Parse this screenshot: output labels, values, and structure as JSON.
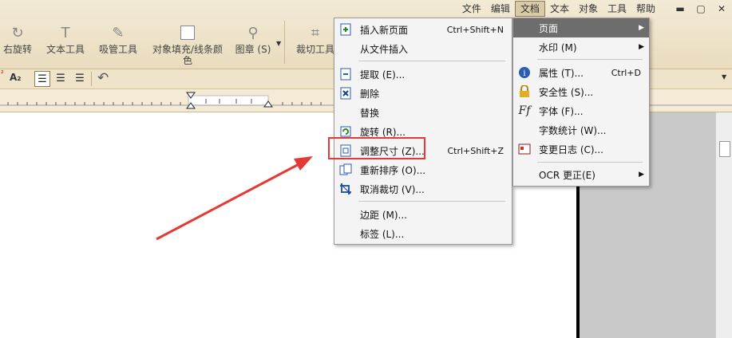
{
  "menubar": [
    "文件",
    "编辑",
    "文档",
    "文本",
    "对象",
    "工具",
    "帮助"
  ],
  "toolbar": {
    "tools": [
      "右旋转",
      "文本工具",
      "吸管工具",
      "对象填充/线条颜色",
      "图章 (S)",
      "裁切工具"
    ]
  },
  "format_bar": {
    "sup_label": "²",
    "sub_label": "A₂"
  },
  "doc_menu": {
    "items": [
      {
        "label": "插入新页面",
        "shortcut": "Ctrl+Shift+N",
        "icon": "insert-page-icon"
      },
      {
        "label": "从文件插入",
        "shortcut": ""
      },
      {
        "label": "提取 (E)...",
        "shortcut": "",
        "icon": "extract-icon"
      },
      {
        "label": "删除",
        "shortcut": "",
        "icon": "delete-page-icon"
      },
      {
        "label": "替换",
        "shortcut": ""
      },
      {
        "label": "旋转 (R)...",
        "shortcut": "",
        "icon": "rotate-icon"
      },
      {
        "label": "调整尺寸 (Z)...",
        "shortcut": "Ctrl+Shift+Z",
        "icon": "resize-icon",
        "highlighted": true
      },
      {
        "label": "重新排序 (O)...",
        "shortcut": "",
        "icon": "reorder-icon"
      },
      {
        "label": "取消裁切 (V)...",
        "shortcut": "",
        "icon": "uncrop-icon"
      },
      {
        "label": "边距 (M)...",
        "shortcut": ""
      },
      {
        "label": "标签 (L)...",
        "shortcut": ""
      }
    ]
  },
  "doc_submenu": {
    "items": [
      {
        "label": "页面",
        "has_arrow": true,
        "selected": true
      },
      {
        "label": "水印 (M)",
        "has_arrow": true
      },
      {
        "label": "属性 (T)...",
        "shortcut": "Ctrl+D",
        "icon": "info-icon"
      },
      {
        "label": "安全性 (S)...",
        "icon": "lock-icon"
      },
      {
        "label": "字体 (F)...",
        "icon": "font-icon"
      },
      {
        "label": "字数统计 (W)..."
      },
      {
        "label": "变更日志 (C)...",
        "icon": "changelog-icon"
      },
      {
        "label": "OCR 更正(E)",
        "has_arrow": true
      }
    ]
  },
  "colors": {
    "highlight_box": "#e53935",
    "arrow": "#e53935",
    "selected_row": "#6d6d6d"
  }
}
